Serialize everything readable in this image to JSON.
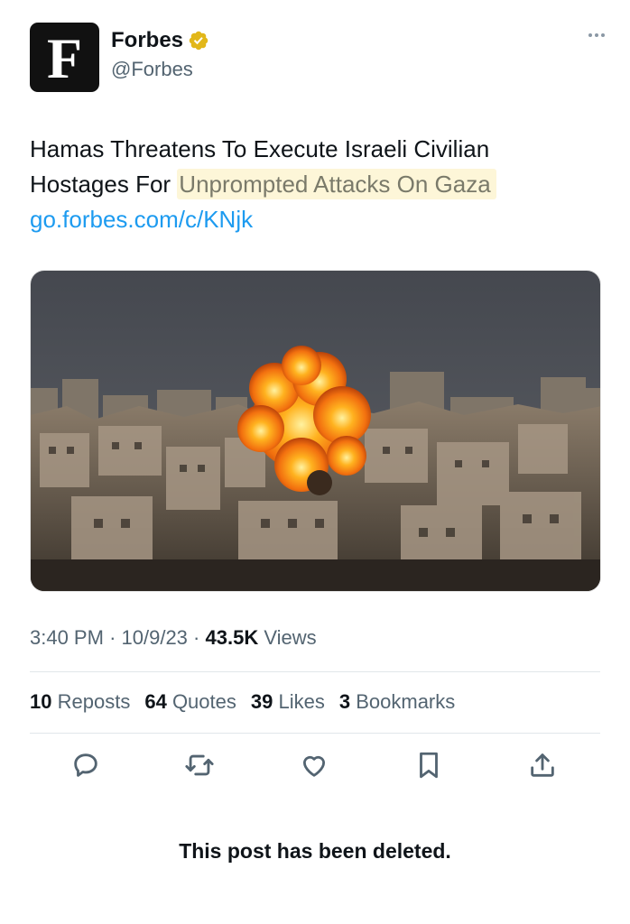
{
  "account": {
    "logo_letter": "F",
    "name": "Forbes",
    "handle": "@Forbes"
  },
  "tweet": {
    "text_line1": "Hamas Threatens To Execute Israeli Civilian",
    "text_line2_prefix": "Hostages For ",
    "text_highlight": "Unprompted Attacks On Gaza",
    "link": "go.forbes.com/c/KNjk"
  },
  "meta": {
    "time": "3:40 PM",
    "date": "10/9/23",
    "views_count": "43.5K",
    "views_label": "Views",
    "sep": "·"
  },
  "stats": [
    {
      "count": "10",
      "label": "Reposts"
    },
    {
      "count": "64",
      "label": "Quotes"
    },
    {
      "count": "39",
      "label": "Likes"
    },
    {
      "count": "3",
      "label": "Bookmarks"
    }
  ],
  "actions": [
    "reply-icon",
    "repost-icon",
    "like-icon",
    "bookmark-icon",
    "share-icon"
  ],
  "notice": "This post has been deleted.",
  "colors": {
    "link": "#1d9bf0",
    "verified": "#e2b719",
    "highlight_bg": "#fdf6d8",
    "icon": "#536471"
  }
}
